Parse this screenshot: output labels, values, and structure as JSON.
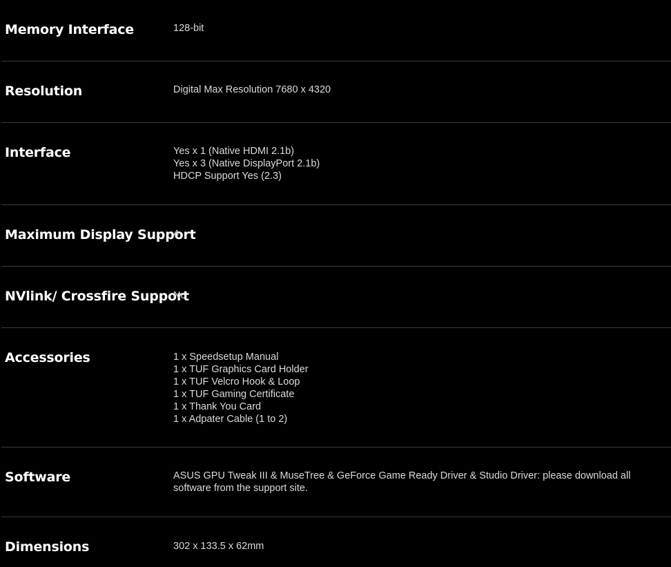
{
  "colors": {
    "background": "#000000",
    "label": "#ffffff",
    "value": "#dadada",
    "divider": "#3a3a3a"
  },
  "specs": [
    {
      "label": "Memory Interface",
      "values": [
        "128-bit"
      ]
    },
    {
      "label": "Resolution",
      "values": [
        "Digital Max Resolution 7680 x 4320"
      ]
    },
    {
      "label": "Interface",
      "values": [
        "Yes x 1 (Native HDMI 2.1b)",
        "Yes x 3 (Native DisplayPort 2.1b)",
        "HDCP Support Yes (2.3)"
      ]
    },
    {
      "label": "Maximum Display Support",
      "values": [
        "4"
      ]
    },
    {
      "label": "NVlink/ Crossfire Support",
      "values": [
        "No"
      ]
    },
    {
      "label": "Accessories",
      "values": [
        "1 x Speedsetup Manual",
        "1 x TUF Graphics Card Holder",
        "1 x TUF Velcro Hook & Loop",
        "1 x TUF Gaming Certificate",
        "1 x Thank You Card",
        "1 x Adpater Cable (1 to 2)"
      ]
    },
    {
      "label": "Software",
      "values": [
        "ASUS GPU Tweak III & MuseTree & GeForce Game Ready Driver & Studio Driver: please download all software from the support site."
      ]
    },
    {
      "label": "Dimensions",
      "values": [
        "302 x 133.5 x 62mm"
      ]
    }
  ]
}
